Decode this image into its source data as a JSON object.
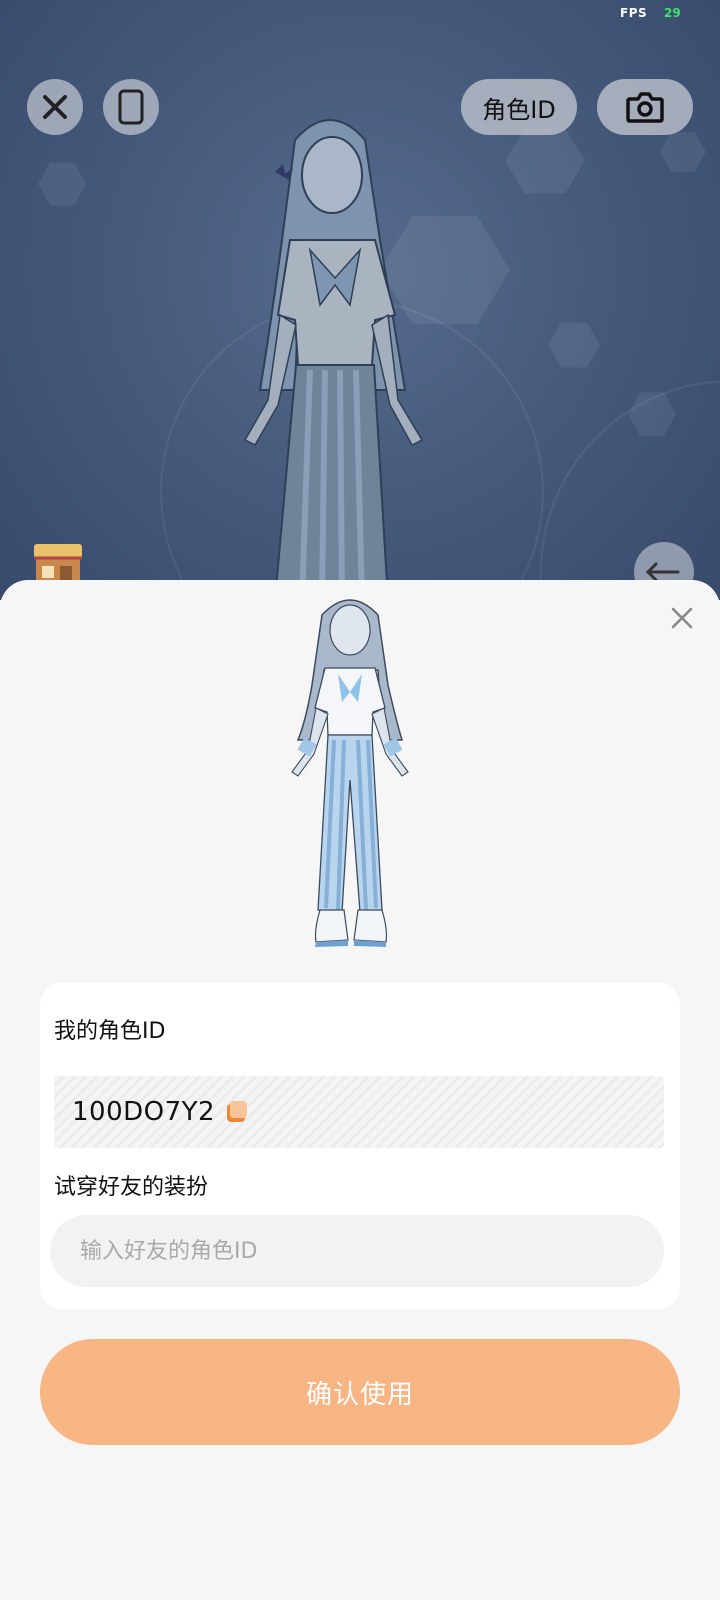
{
  "status": {
    "fps_label": "FPS",
    "fps_value": "29"
  },
  "toolbar": {
    "role_id_label": "角色ID"
  },
  "sheet": {
    "my_id_label": "我的角色ID",
    "my_id_value": "100DO7Y2",
    "tryon_label": "试穿好友的装扮",
    "friend_input_placeholder": "输入好友的角色ID",
    "friend_input_value": "",
    "confirm_label": "确认使用"
  },
  "colors": {
    "accent": "#f8b584",
    "fps_value": "#3ee36b",
    "scene_bg": "#4a5f80"
  },
  "icons": [
    "close-icon",
    "phone-frame-icon",
    "camera-icon",
    "shop-icon",
    "back-arrow-icon",
    "copy-icon"
  ]
}
